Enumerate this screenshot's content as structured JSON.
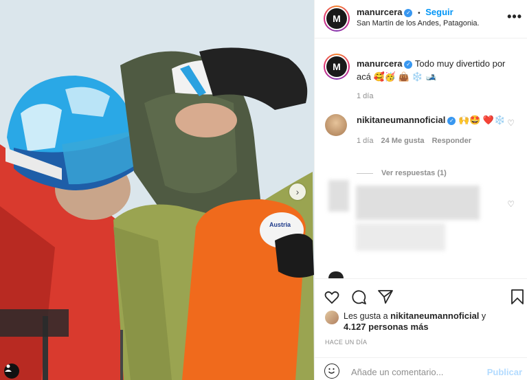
{
  "post": {
    "account": "manurcera",
    "follow_label": "Seguir",
    "dot": "•",
    "location": "San Martín de los Andes, Patagonia.",
    "more_label": "•••",
    "avatar_logo": "M"
  },
  "caption": {
    "username": "manurcera",
    "text": "Todo muy divertido por acá 🥰🥳 👜 ❄️ 🎿",
    "time": "1 día"
  },
  "comment": {
    "username": "nikitaneumannoficial",
    "text": "🙌🤩 ❤️❄️",
    "time": "1 día",
    "likes": "24 Me gusta",
    "reply_label": "Responder",
    "view_replies": "Ver respuestas (1)"
  },
  "likes": {
    "prefix": "Les gusta a ",
    "user": "nikitaneumannoficial",
    "connector": " y",
    "count": "4.127 personas más"
  },
  "date": "HACE UN DÍA",
  "comment_input": {
    "placeholder": "Añade un comentario...",
    "publish_label": "Publicar"
  },
  "icons": {
    "verified": "verified-badge",
    "like": "heart-icon",
    "comment": "comment-icon",
    "share": "share-icon",
    "save": "bookmark-icon",
    "emoji": "smiley-icon"
  },
  "colors": {
    "accent": "#0095f6",
    "verified": "#3897f0"
  }
}
